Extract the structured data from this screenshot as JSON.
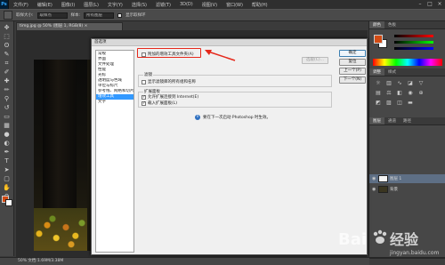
{
  "app": {
    "logo": "Ps"
  },
  "menu": [
    "文件(F)",
    "编辑(E)",
    "图像(I)",
    "图层(L)",
    "文字(Y)",
    "选择(S)",
    "滤镜(T)",
    "3D(D)",
    "视图(V)",
    "窗口(W)",
    "帮助(H)"
  ],
  "window_controls": [
    "–",
    "□",
    "×"
  ],
  "options_bar": {
    "sample_size_label": "取样大小:",
    "sample_size_value": "取样点",
    "sample_label": "样本:",
    "sample_value": "所有图层",
    "show_ring_label": "显示取样环"
  },
  "document": {
    "tab_title": "timg.jpg @ 50% (图层 1, RGB/8) ×",
    "status": "50%  文档:1.69M/3.38M"
  },
  "tools_icons": [
    "move-icon",
    "marquee-icon",
    "lasso-icon",
    "quick-select-icon",
    "crop-icon",
    "eyedropper-icon",
    "healing-icon",
    "brush-icon",
    "stamp-icon",
    "history-brush-icon",
    "eraser-icon",
    "gradient-icon",
    "blur-icon",
    "dodge-icon",
    "pen-icon",
    "type-icon",
    "path-select-icon",
    "shape-icon",
    "hand-icon",
    "zoom-icon"
  ],
  "tools_glyphs": [
    "✥",
    "⬚",
    "ʘ",
    "✎",
    "⌗",
    "✐",
    "✚",
    "✏",
    "⚲",
    "↺",
    "▭",
    "▦",
    "●",
    "◐",
    "✒",
    "T",
    "➤",
    "▢",
    "✋",
    "⚲"
  ],
  "panels": {
    "color_tabs": [
      "颜色",
      "色板"
    ],
    "adjust_tabs": [
      "调整",
      "样式"
    ],
    "layers_tabs": [
      "图层",
      "通道",
      "路径"
    ],
    "layers": [
      {
        "name": "图层 1",
        "selected": true,
        "thumb_color": "#f4f4f4"
      },
      {
        "name": "背景",
        "selected": false,
        "thumb_color": "#3a3520"
      }
    ]
  },
  "dialog": {
    "title": "首选项",
    "nav": [
      "常规",
      "界面",
      "文件处理",
      "性能",
      "光标",
      "透明度与色域",
      "单位与标尺",
      "参考线、网格和切片",
      "增效工具",
      "文字"
    ],
    "nav_selected_index": 8,
    "options": {
      "additional_plugins": "附加的增效工具文件夹(A)",
      "choose_button": "选取(C)...",
      "filters_group": "滤镜",
      "show_filter_gallery": "显示滤镜库的所有组和名称",
      "extension_group": "扩展面板",
      "allow_extensions": "允许扩展连接到 Internet(E)",
      "load_extensions": "载入扩展面板(L)"
    },
    "buttons": {
      "ok": "确定",
      "reset": "复位",
      "prev": "上一个(P)",
      "next": "下一个(N)"
    },
    "info_text": "要在下一次启动 Photoshop 时生效。"
  },
  "watermark": {
    "brand": "Bai",
    "brand2": "经验",
    "url": "jingyan.baidu.com"
  },
  "colors": {
    "foreground": "#d24b14",
    "highlight": "#e5281b",
    "selection": "#3399ff"
  }
}
